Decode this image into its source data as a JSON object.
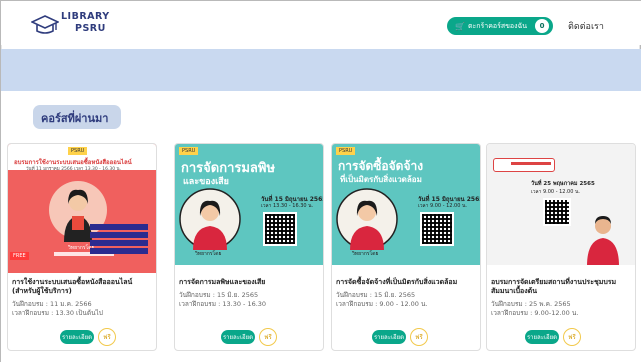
{
  "header": {
    "logo": {
      "line1": "LIBRARY",
      "line2": "PSRU"
    },
    "cart": {
      "label": "ตะกร้าคอร์สของฉัน",
      "count": "0",
      "icon": "cart-icon"
    },
    "contact_label": "ติดต่อเรา"
  },
  "section": {
    "title": "คอร์สที่ผ่านมา"
  },
  "courses": [
    {
      "title": "การใช้งานระบบเสนอซื้อหนังสือออนไลน์ (สำหรับผู้ใช้บริการ)",
      "date": "วันฝึกอบรม : 11 ม.ค. 2566",
      "time": "เวลาฝึกอบรม : 13.30 เป็นต้นไป",
      "button": "รายละเอียด",
      "badge": "ฟรี",
      "poster_text": "อบรมการใช้งานระบบเสนอซื้อหนังสือออนไลน์",
      "poster_sub": "วันที่ 11 มกราคม 2566 เวลา 13.30 - 16.30 น.",
      "speaker": "วิทยากรโดย",
      "poster_color": "#f0605e"
    },
    {
      "title": "การจัดการมลพิษและของเสีย",
      "date": "วันฝึกอบรม : 15 มิ.ย. 2565",
      "time": "เวลาฝึกอบรม : 13.30 - 16.30",
      "button": "รายละเอียด",
      "badge": "ฟรี",
      "poster_text": "การจัดการมลพิษ",
      "poster_text2": "และของเสีย",
      "poster_sub": "วันที่ 15 มิถุนายน 2565",
      "poster_sub2": "เวลา 13.30 - 16.30 น.",
      "speaker": "วิทยากรโดย",
      "poster_color": "#5ec6c0"
    },
    {
      "title": "การจัดซื้อจัดจ้างที่เป็นมิตรกับสิ่งแวดล้อม",
      "date": "วันฝึกอบรม : 15 มิ.ย. 2565",
      "time": "เวลาฝึกอบรม : 9.00 - 12.00 น.",
      "button": "รายละเอียด",
      "badge": "ฟรี",
      "poster_text": "การจัดซื้อจัดจ้าง",
      "poster_text2": "ที่เป็นมิตรกับสิ่งแวดล้อม",
      "poster_sub": "วันที่ 15 มิถุนายน 2565",
      "poster_sub2": "เวลา 9.00 - 12.00 น.",
      "speaker": "วิทยากรโดย",
      "poster_color": "#5ec6c0"
    },
    {
      "title": "อบรมการจัดเตรียมสถานที่งานประชุมบรม สัมมนาเบื้องต้น",
      "date": "วันฝึกอบรม : 25 พ.ค. 2565",
      "time": "เวลาฝึกอบรม : 9.00-12.00 น.",
      "button": "รายละเอียด",
      "badge": "ฟรี",
      "poster_sub": "วันที่ 25 พฤษภาคม 2565",
      "poster_sub2": "เวลา 9.00 - 12.00 น.",
      "poster_color": "#f3f3f3"
    }
  ]
}
